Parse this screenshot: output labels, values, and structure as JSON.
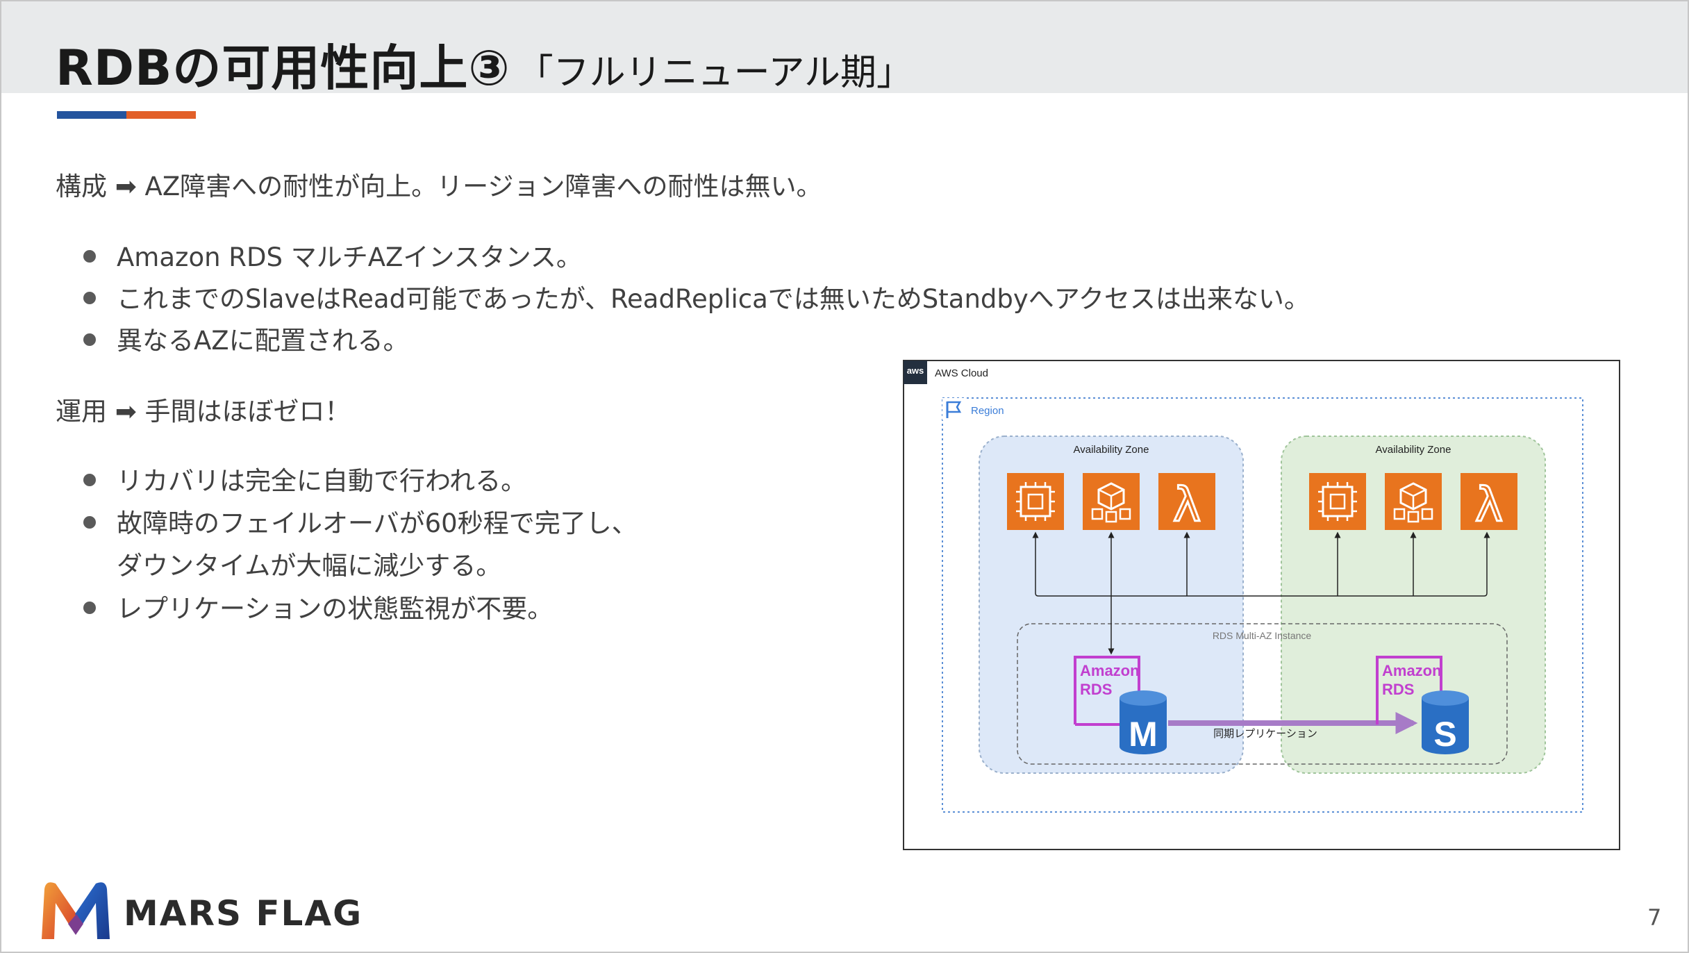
{
  "title": {
    "main": "RDBの可用性向上③",
    "sub": "「フルリニューアル期」"
  },
  "section1": {
    "heading": "構成 ➡ AZ障害への耐性が向上。リージョン障害への耐性は無い。",
    "bullets": [
      "Amazon RDS マルチAZインスタンス。",
      "これまでのSlaveはRead可能であったが、ReadReplicaでは無いためStandbyへアクセスは出来ない。",
      "異なるAZに配置される。"
    ]
  },
  "section2": {
    "heading": "運用 ➡ 手間はほぼゼロ！",
    "bullets": [
      "リカバリは完全に自動で行われる。",
      "故障時のフェイルオーバが60秒程で完了し、",
      "レプリケーションの状態監視が不要。"
    ],
    "bullet2_cont": "ダウンタイムが大幅に減少する。"
  },
  "diagram": {
    "aws_badge": "aws",
    "cloud_label": "AWS Cloud",
    "region_label": "Region",
    "az_left_label": "Availability Zone",
    "az_right_label": "Availability Zone",
    "multi_az_label": "RDS Multi-AZ Instance",
    "rds_left_line1": "Amazon",
    "rds_left_line2": "RDS",
    "rds_right_line1": "Amazon",
    "rds_right_line2": "RDS",
    "master_letter": "M",
    "standby_letter": "S",
    "replication_label": "同期レプリケーション",
    "lambda_symbol": "λ",
    "icons": [
      "ec2-icon",
      "ecs-icon",
      "lambda-icon"
    ]
  },
  "footer": {
    "brand": "MARS FLAG",
    "page": "7"
  },
  "colors": {
    "title_bg": "#e8eaeb",
    "accent_blue": "#24549e",
    "accent_orange": "#e25f28",
    "compute_orange": "#e8741e",
    "rds_magenta": "#c13fcf",
    "db_blue": "#2a6fc4",
    "az_left_bg": "#dde8f8",
    "az_right_bg": "#e0eedb",
    "replication_arrow": "#a77bc7"
  }
}
